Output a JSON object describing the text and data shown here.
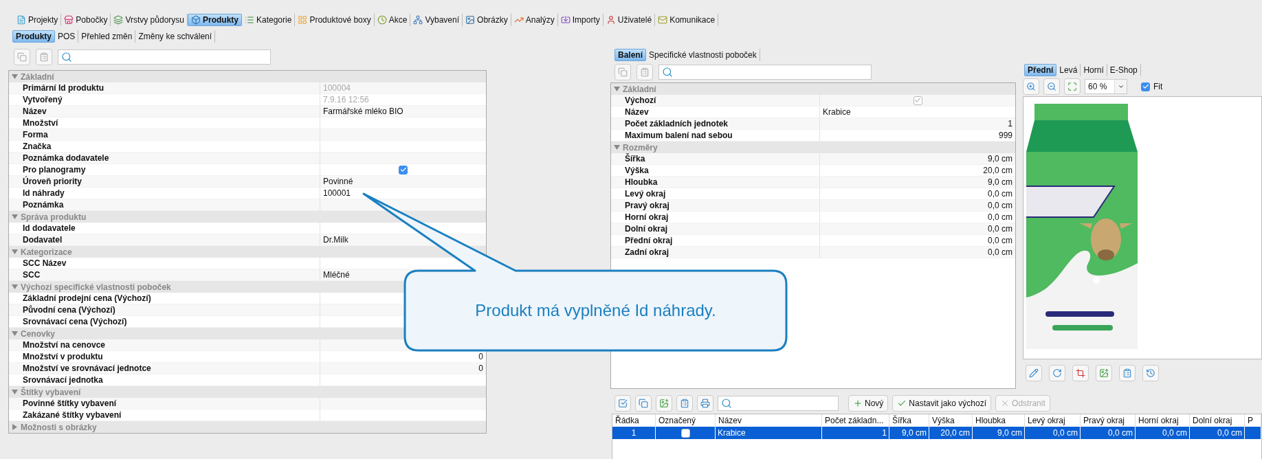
{
  "main_tabs": [
    {
      "label": "Projekty",
      "selected": false
    },
    {
      "label": "Pobočky",
      "selected": false
    },
    {
      "label": "Vrstvy půdorysu",
      "selected": false
    },
    {
      "label": "Produkty",
      "selected": true
    },
    {
      "label": "Kategorie",
      "selected": false
    },
    {
      "label": "Produktové boxy",
      "selected": false
    },
    {
      "label": "Akce",
      "selected": false
    },
    {
      "label": "Vybavení",
      "selected": false
    },
    {
      "label": "Obrázky",
      "selected": false
    },
    {
      "label": "Analýzy",
      "selected": false
    },
    {
      "label": "Importy",
      "selected": false
    },
    {
      "label": "Uživatelé",
      "selected": false
    },
    {
      "label": "Komunikace",
      "selected": false
    }
  ],
  "sub_tabs": [
    {
      "label": "Produkty",
      "selected": true
    },
    {
      "label": "POS",
      "selected": false
    },
    {
      "label": "Přehled změn",
      "selected": false
    },
    {
      "label": "Změny ke schválení",
      "selected": false
    }
  ],
  "product_properties": {
    "groups": [
      {
        "title": "Základní",
        "expanded": true,
        "rows": [
          {
            "label": "Primární Id produktu",
            "kind": "muted",
            "value": "100004"
          },
          {
            "label": "Vytvořený",
            "kind": "muted",
            "value": "7.9.16 12:56"
          },
          {
            "label": "Název",
            "kind": "text",
            "value": "Farmářské mléko BIO"
          },
          {
            "label": "Množství",
            "kind": "text"
          },
          {
            "label": "Forma",
            "kind": "text"
          },
          {
            "label": "Značka",
            "kind": "text"
          },
          {
            "label": "Poznámka dodavatele",
            "kind": "text"
          },
          {
            "label": "Pro planogramy",
            "kind": "check",
            "checked": true,
            "disabled": false
          },
          {
            "label": "Úroveň priority",
            "kind": "text",
            "value": "Povinné"
          },
          {
            "label": "Id náhrady",
            "kind": "text",
            "value": "100001"
          },
          {
            "label": "Poznámka",
            "kind": "text"
          }
        ]
      },
      {
        "title": "Správa produktu",
        "expanded": true,
        "rows": [
          {
            "label": "Id dodavatele",
            "kind": "text"
          },
          {
            "label": "Dodavatel",
            "kind": "text",
            "value": "Dr.Milk"
          }
        ]
      },
      {
        "title": "Kategorizace",
        "expanded": true,
        "rows": [
          {
            "label": "SCC Název",
            "kind": "text"
          },
          {
            "label": "SCC",
            "kind": "text",
            "value": "Mléčné"
          }
        ]
      },
      {
        "title": "Výchozí specifické vlastnosti poboček",
        "expanded": true,
        "rows": [
          {
            "label": "Základní prodejní cena (Výchozí)",
            "kind": "text"
          },
          {
            "label": "Původní cena (Výchozí)",
            "kind": "text"
          },
          {
            "label": "Srovnávací cena (Výchozí)",
            "kind": "text"
          }
        ]
      },
      {
        "title": "Cenovky",
        "expanded": true,
        "rows": [
          {
            "label": "Množství na cenovce",
            "kind": "number"
          },
          {
            "label": "Množství v produktu",
            "kind": "number",
            "value": "0"
          },
          {
            "label": "Množství ve srovnávací jednotce",
            "kind": "number",
            "value": "0"
          },
          {
            "label": "Srovnávací jednotka",
            "kind": "text"
          }
        ]
      },
      {
        "title": "Štítky vybavení",
        "expanded": true,
        "rows": [
          {
            "label": "Povinné štítky vybavení",
            "kind": "text"
          },
          {
            "label": "Zakázané štítky vybavení",
            "kind": "text"
          }
        ]
      },
      {
        "title": "Možnosti s obrázky",
        "expanded": false
      }
    ]
  },
  "packaging_tabs": [
    {
      "label": "Balení",
      "selected": true
    },
    {
      "label": "Specifické vlastnosti poboček",
      "selected": false
    }
  ],
  "packaging_properties": {
    "groups": [
      {
        "title": "Základní",
        "expanded": true,
        "rows": [
          {
            "label": "Výchozí",
            "kind": "check",
            "checked": true,
            "disabled": true
          },
          {
            "label": "Název",
            "kind": "text",
            "value": "Krabice"
          },
          {
            "label": "Počet základních jednotek",
            "kind": "number",
            "value": "1"
          },
          {
            "label": "Maximum balení nad sebou",
            "kind": "number",
            "value": "999"
          }
        ]
      },
      {
        "title": "Rozměry",
        "expanded": true,
        "rows": [
          {
            "label": "Šířka",
            "kind": "number",
            "value": "9,0 cm"
          },
          {
            "label": "Výška",
            "kind": "number",
            "value": "20,0 cm"
          },
          {
            "label": "Hloubka",
            "kind": "number",
            "value": "9,0 cm"
          },
          {
            "label": "Levý okraj",
            "kind": "number",
            "value": "0,0 cm"
          },
          {
            "label": "Pravý okraj",
            "kind": "number",
            "value": "0,0 cm"
          },
          {
            "label": "Horní okraj",
            "kind": "number",
            "value": "0,0 cm"
          },
          {
            "label": "Dolní okraj",
            "kind": "number",
            "value": "0,0 cm"
          },
          {
            "label": "Přední okraj",
            "kind": "number",
            "value": "0,0 cm"
          },
          {
            "label": "Zadní okraj",
            "kind": "number",
            "value": "0,0 cm"
          }
        ]
      }
    ]
  },
  "image_tabs": [
    {
      "label": "Přední",
      "selected": true
    },
    {
      "label": "Levá",
      "selected": false
    },
    {
      "label": "Horní",
      "selected": false
    },
    {
      "label": "E-Shop",
      "selected": false
    }
  ],
  "zoom": {
    "value": "60 %"
  },
  "fit": {
    "label": "Fit",
    "checked": true
  },
  "packaging_table": {
    "buttons": [
      {
        "kind": "add",
        "label": "Nový",
        "disabled": false
      },
      {
        "kind": "set-default",
        "label": "Nastavit jako výchozí",
        "disabled": false
      },
      {
        "kind": "remove",
        "label": "Odstranit",
        "disabled": true
      }
    ],
    "columns": [
      "Řádka",
      "Označený",
      "Název",
      "Počet základn...",
      "Šířka",
      "Výška",
      "Hloubka",
      "Levý okraj",
      "Pravý okraj",
      "Horní okraj",
      "Dolní okraj",
      "P"
    ],
    "rows": [
      {
        "selected": true,
        "marked": false,
        "cells": [
          "1",
          "",
          "Krabice",
          "1",
          "9,0 cm",
          "20,0 cm",
          "9,0 cm",
          "0,0 cm",
          "0,0 cm",
          "0,0 cm",
          "0,0 cm"
        ]
      }
    ]
  },
  "callout": {
    "text": "Produkt má vyplněné Id náhrady."
  }
}
